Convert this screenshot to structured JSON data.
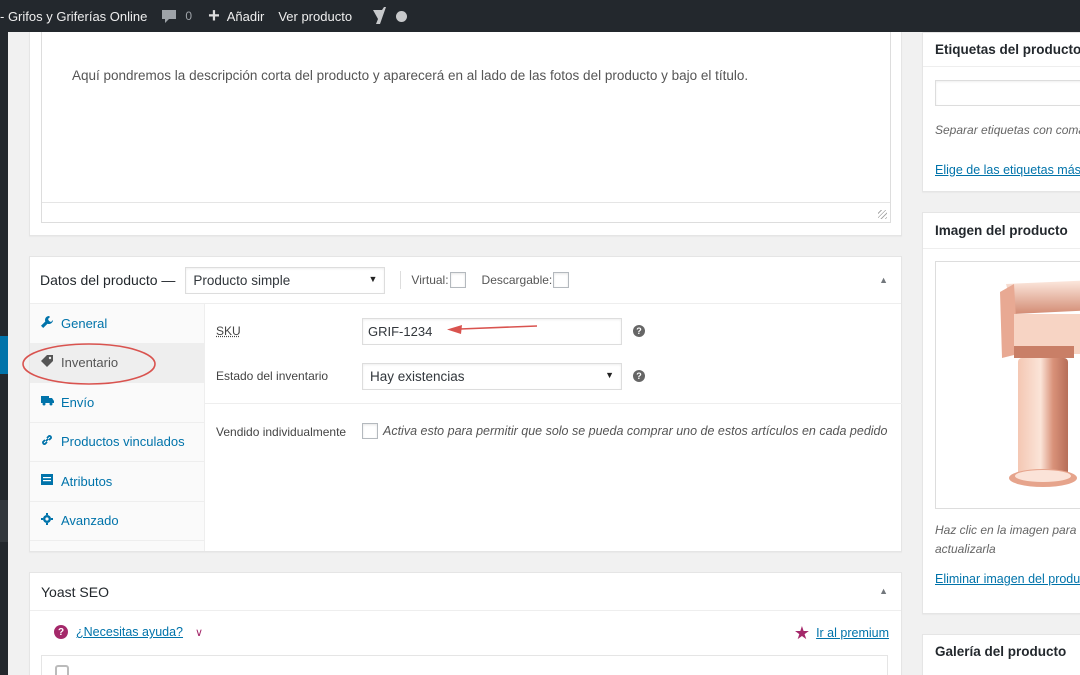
{
  "adminbar": {
    "site_name": "- Grifos y Griferías Online",
    "comments_count": "0",
    "new_label": "Añadir",
    "view_label": "Ver producto"
  },
  "excerpt": {
    "text": "Aquí pondremos la descripción corta del producto y aparecerá en al lado de las fotos del producto y bajo el título."
  },
  "product_data": {
    "title": "Datos del producto —",
    "type_selected": "Producto simple",
    "virtual_label": "Virtual:",
    "downloadable_label": "Descargable:",
    "tabs": [
      {
        "label": "General",
        "icon": "wrench-icon"
      },
      {
        "label": "Inventario",
        "icon": "tag-icon"
      },
      {
        "label": "Envío",
        "icon": "truck-icon"
      },
      {
        "label": "Productos vinculados",
        "icon": "link-icon"
      },
      {
        "label": "Atributos",
        "icon": "list-icon"
      },
      {
        "label": "Avanzado",
        "icon": "gear-icon"
      }
    ],
    "active_tab": "Inventario",
    "inventory": {
      "sku_label": "SKU",
      "sku_value": "GRIF-1234",
      "stock_label": "Estado del inventario",
      "stock_value": "Hay existencias",
      "sold_individually_label": "Vendido individualmente",
      "sold_individually_desc": "Activa esto para permitir que solo se pueda comprar uno de estos artículos en cada pedido"
    },
    "annotation_color": "#d9534f"
  },
  "yoast": {
    "title": "Yoast SEO",
    "help_label": "¿Necesitas ayuda?",
    "premium_label": "Ir al premium",
    "accent_color": "#a4286a"
  },
  "sidebar": {
    "tags": {
      "title": "Etiquetas del producto",
      "hint": "Separar etiquetas con coma",
      "choose_link": "Elige de las etiquetas más"
    },
    "image": {
      "title": "Imagen del producto",
      "hint_line1": "Haz clic en la imagen para",
      "hint_line2": "actualizarla",
      "remove_link": "Eliminar imagen del producto"
    },
    "gallery": {
      "title": "Galería del producto"
    }
  }
}
